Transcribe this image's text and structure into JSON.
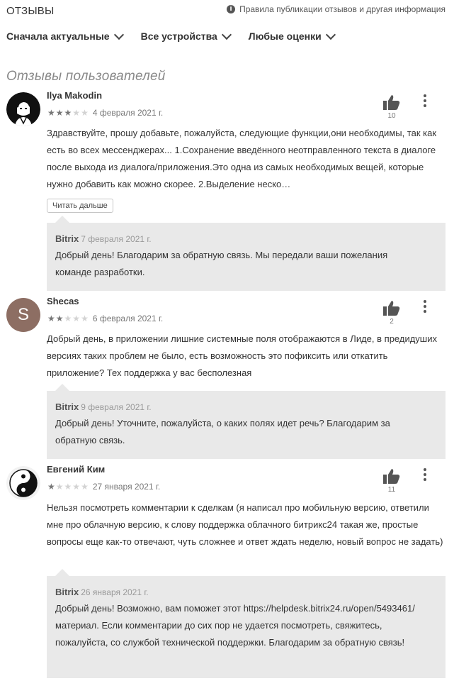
{
  "header": {
    "title": "ОТЗЫВЫ",
    "policy_link": "Правила публикации отзывов и другая информация"
  },
  "filters": [
    {
      "label": "Сначала актуальные"
    },
    {
      "label": "Все устройства"
    },
    {
      "label": "Любые оценки"
    }
  ],
  "section_title": "Отзывы пользователей",
  "reviews": [
    {
      "author": "Ilya Makodin",
      "rating": 3,
      "max_rating": 5,
      "date": "4 февраля 2021 г.",
      "likes": "10",
      "text": "Здравствуйте, прошу добавьте, пожалуйста, следующие функции,они необходимы, так как есть во всех мессенджерах... 1.Сохранение введённого неотправленного текста в диалоге после выхода из диалога/приложения.Это одна из самых необходимых вещей, которые нужно добавить как можно скорее. 2.Выделение неско…",
      "read_more": "Читать дальше",
      "reply": {
        "author": "Bitrix",
        "date": "7 февраля 2021 г.",
        "text": "Добрый день! Благодарим за обратную связь. Мы передали ваши пожелания команде разработки."
      }
    },
    {
      "author": "Shecas",
      "avatar_letter": "S",
      "rating": 2,
      "max_rating": 5,
      "date": "6 февраля 2021 г.",
      "likes": "2",
      "text": "Добрый день, в приложении лишние системные поля отображаются в Лиде, в предидуших версиях таких проблем не было, есть возможность это пофиксить или откатить приложение? Тех поддержка у вас бесполезная",
      "reply": {
        "author": "Bitrix",
        "date": "9 февраля 2021 г.",
        "text": "Добрый день! Уточните, пожалуйста, о каких полях идет речь? Благодарим за обратную связь."
      }
    },
    {
      "author": "Евгений Ким",
      "rating": 1,
      "max_rating": 5,
      "date": "27 января 2021 г.",
      "likes": "11",
      "text": "Нельзя посмотреть комментарии к сделкам (я написал про мобильную версию, ответили мне про облачную версию, к слову поддержка облачного битрикс24 такая же, простые вопросы еще как-то отвечают, чуть сложнее и ответ ждать неделю, новый вопрос не задать)",
      "reply": {
        "author": "Bitrix",
        "date": "26 января 2021 г.",
        "text": "Добрый день! Возможно, вам поможет этот https://helpdesk.bitrix24.ru/open/5493461/ материал. Если комментарии до сих пор не удается посмотреть, свяжитесь, пожалуйста, со службой технической поддержки. Благодарим за обратную связь!"
      }
    }
  ],
  "icons": {
    "info": "info-icon",
    "thumb": "thumb-up-icon",
    "more": "more-vert-icon",
    "chevron": "chevron-down-icon",
    "star": "star-icon"
  },
  "colors": {
    "reply_background": "#e9e9e9",
    "star_filled": "#777777",
    "star_empty": "#d3d3d3"
  }
}
